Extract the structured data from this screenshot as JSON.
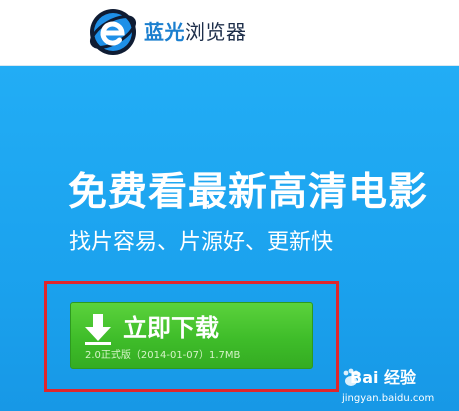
{
  "header": {
    "brand_part1": "蓝光",
    "brand_part2": "浏览器",
    "logo_icon": "ie-style-e-logo-icon"
  },
  "hero": {
    "headline": "免费看最新高清电影",
    "subline": "找片容易、片源好、更新快"
  },
  "download": {
    "label": "立即下载",
    "meta": "2.0正式版（2014-01-07）1.7MB",
    "icon": "download-arrow-icon"
  },
  "watermark": {
    "text": "Bai 经验",
    "url": "jingyan.baidu.com",
    "icon": "baidu-paw-icon"
  },
  "colors": {
    "hero_blue": "#1aa3ee",
    "button_green": "#43c12e",
    "highlight_red": "#e0262c",
    "brand_blue": "#1b7fcf"
  }
}
